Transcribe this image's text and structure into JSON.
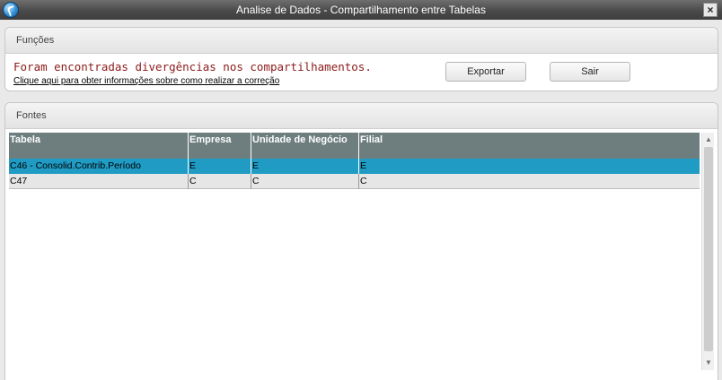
{
  "window": {
    "title": "Analise de Dados - Compartilhamento entre Tabelas",
    "close_label": "×"
  },
  "funcoes": {
    "header": "Funções",
    "message": "Foram encontradas divergências nos compartilhamentos.",
    "link": "Clique aqui para obter informações sobre como realizar a correção",
    "export_label": "Exportar",
    "exit_label": "Sair"
  },
  "fontes": {
    "header": "Fontes",
    "columns": [
      "Tabela",
      "Empresa",
      "Unidade de Negócio",
      "Filial"
    ],
    "rows": [
      [
        "C46 - Consolid.Contrib.Período",
        "E",
        "E",
        "E"
      ],
      [
        "C47",
        "C",
        "C",
        "C"
      ]
    ],
    "scroll_up": "▲",
    "scroll_down": "▼"
  },
  "colors": {
    "selected_row": "#1f9bc4",
    "header_bg": "#6e7e7f",
    "message_text": "#8b1a1a"
  }
}
